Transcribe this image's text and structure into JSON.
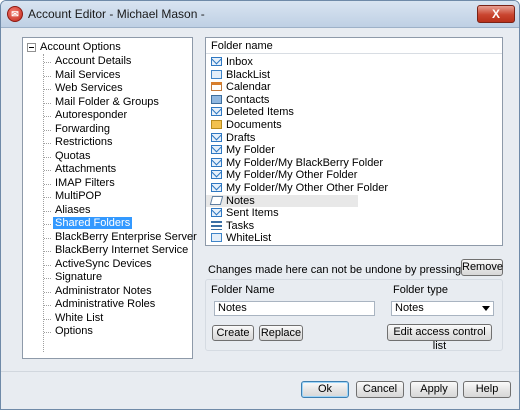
{
  "window": {
    "title": "Account Editor - Michael Mason -",
    "close_label": "X"
  },
  "tree": {
    "root_label": "Account Options",
    "items": [
      {
        "label": "Account Details",
        "selected": false
      },
      {
        "label": "Mail Services",
        "selected": false
      },
      {
        "label": "Web Services",
        "selected": false
      },
      {
        "label": "Mail Folder & Groups",
        "selected": false
      },
      {
        "label": "Autoresponder",
        "selected": false
      },
      {
        "label": "Forwarding",
        "selected": false
      },
      {
        "label": "Restrictions",
        "selected": false
      },
      {
        "label": "Quotas",
        "selected": false
      },
      {
        "label": "Attachments",
        "selected": false
      },
      {
        "label": "IMAP Filters",
        "selected": false
      },
      {
        "label": "MultiPOP",
        "selected": false
      },
      {
        "label": "Aliases",
        "selected": false
      },
      {
        "label": "Shared Folders",
        "selected": true
      },
      {
        "label": "BlackBerry Enterprise Server",
        "selected": false
      },
      {
        "label": "BlackBerry Internet Service",
        "selected": false
      },
      {
        "label": "ActiveSync Devices",
        "selected": false
      },
      {
        "label": "Signature",
        "selected": false
      },
      {
        "label": "Administrator Notes",
        "selected": false
      },
      {
        "label": "Administrative Roles",
        "selected": false
      },
      {
        "label": "White List",
        "selected": false
      },
      {
        "label": "Options",
        "selected": false
      }
    ]
  },
  "folder_list": {
    "header": "Folder name",
    "rows": [
      {
        "name": "Inbox",
        "icon": "mail-icon"
      },
      {
        "name": "BlackList",
        "icon": "folder-icon"
      },
      {
        "name": "Calendar",
        "icon": "calendar-icon"
      },
      {
        "name": "Contacts",
        "icon": "contacts-icon"
      },
      {
        "name": "Deleted Items",
        "icon": "mail-icon"
      },
      {
        "name": "Documents",
        "icon": "documents-icon"
      },
      {
        "name": "Drafts",
        "icon": "mail-icon"
      },
      {
        "name": "My Folder",
        "icon": "mail-icon"
      },
      {
        "name": "My Folder/My BlackBerry Folder",
        "icon": "mail-icon"
      },
      {
        "name": "My Folder/My Other Folder",
        "icon": "mail-icon"
      },
      {
        "name": "My Folder/My Other Other Folder",
        "icon": "mail-icon"
      },
      {
        "name": "Notes",
        "icon": "notes-icon",
        "selected": true
      },
      {
        "name": "Sent Items",
        "icon": "mail-icon"
      },
      {
        "name": "Tasks",
        "icon": "tasks-icon"
      },
      {
        "name": "WhiteList",
        "icon": "folder-icon"
      }
    ]
  },
  "notice": "Changes made here can not be undone by pressing Cancel.",
  "buttons": {
    "remove": "Remove",
    "create": "Create",
    "replace": "Replace",
    "edit_acl": "Edit access control list",
    "ok": "Ok",
    "cancel": "Cancel",
    "apply": "Apply",
    "help": "Help"
  },
  "form": {
    "folder_name_label": "Folder Name",
    "folder_name_value": "Notes",
    "folder_type_label": "Folder type",
    "folder_type_value": "Notes"
  }
}
